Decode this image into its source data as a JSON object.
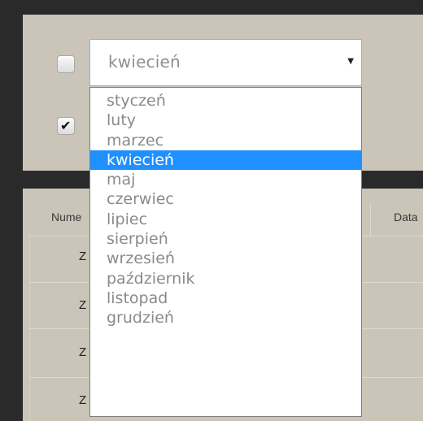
{
  "select": {
    "value": "kwiecień",
    "arrow_icon": "▼",
    "options": [
      "styczeń",
      "luty",
      "marzec",
      "kwiecień",
      "maj",
      "czerwiec",
      "lipiec",
      "sierpień",
      "wrzesień",
      "październik",
      "listopad",
      "grudzień"
    ],
    "selected_index": 3
  },
  "filters": {
    "checkbox_1": {
      "checked": false
    },
    "checkbox_2": {
      "checked": true,
      "check_glyph": "✔"
    }
  },
  "table": {
    "headers": {
      "col1": "Nume",
      "col2": "Data"
    },
    "rows": [
      "Z",
      "Z",
      "Z",
      "Z"
    ]
  },
  "colors": {
    "panel": "#cbc4b9",
    "frame": "#2a2a2a",
    "highlight": "#1e90ff"
  }
}
